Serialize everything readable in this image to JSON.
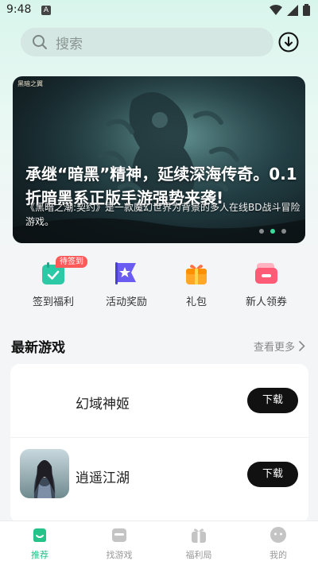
{
  "status_bar": {
    "time": "9:48",
    "notification_icon": "A"
  },
  "search": {
    "placeholder": "搜索"
  },
  "banner": {
    "logo_text": "黑暗之翼",
    "title": "承继“暗黑”精神，延续深海传奇。0.1折暗黑系正版手游强势来袭!",
    "description": "《黑暗之潮:契约》是一款魔幻世界为背景的多人在线BD战斗冒险游戏。",
    "dots": 3,
    "active_dot": 1
  },
  "quick_entries": [
    {
      "label": "签到福利",
      "icon": "calendar-check-icon",
      "badge": "待签到"
    },
    {
      "label": "活动奖励",
      "icon": "star-flag-icon"
    },
    {
      "label": "礼包",
      "icon": "gift-box-icon"
    },
    {
      "label": "新人领券",
      "icon": "wallet-coupon-icon"
    }
  ],
  "section": {
    "title": "最新游戏",
    "more": "查看更多"
  },
  "games": [
    {
      "name": "幻域神姬",
      "button": "下载"
    },
    {
      "name": "逍遥江湖",
      "button": "下载"
    }
  ],
  "bottom_nav": [
    {
      "label": "推荐",
      "icon": "home-smile-icon",
      "active": true
    },
    {
      "label": "找游戏",
      "icon": "game-box-icon",
      "active": false
    },
    {
      "label": "福利局",
      "icon": "gift-icon",
      "active": false
    },
    {
      "label": "我的",
      "icon": "face-icon",
      "active": false
    }
  ],
  "colors": {
    "accent": "#25c28a",
    "badge": "#ff5a5a",
    "button": "#111111"
  }
}
